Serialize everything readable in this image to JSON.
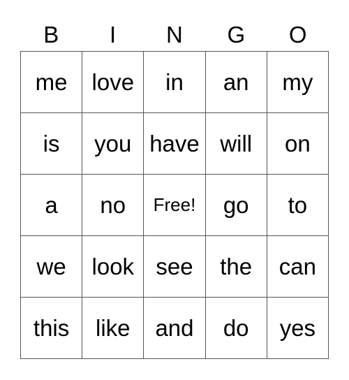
{
  "header": {
    "letters": [
      "B",
      "I",
      "N",
      "G",
      "O"
    ]
  },
  "board": {
    "rows": [
      [
        "me",
        "love",
        "in",
        "an",
        "my"
      ],
      [
        "is",
        "you",
        "have",
        "will",
        "on"
      ],
      [
        "a",
        "no",
        "Free!",
        "go",
        "to"
      ],
      [
        "we",
        "look",
        "see",
        "the",
        "can"
      ],
      [
        "this",
        "like",
        "and",
        "do",
        "yes"
      ]
    ],
    "free_space": {
      "row": 2,
      "col": 2
    }
  }
}
